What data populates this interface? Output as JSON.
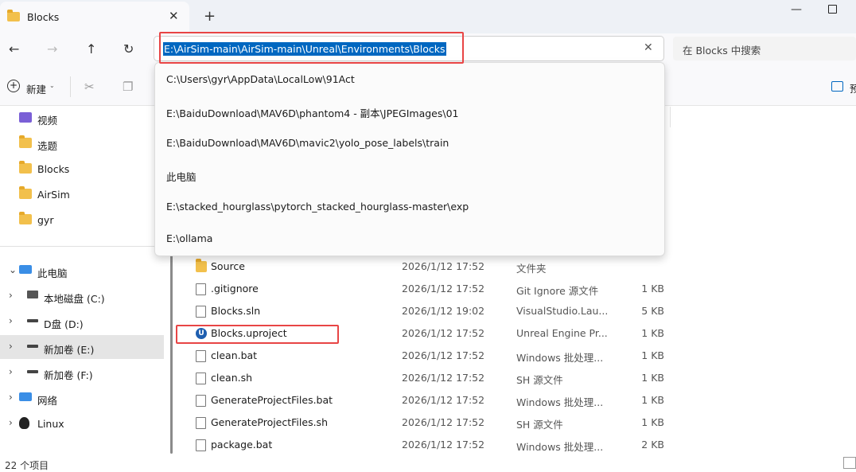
{
  "tab": {
    "title": "Blocks",
    "close": "✕",
    "new": "+"
  },
  "window": {
    "minimize": "—"
  },
  "nav": {
    "back": "←",
    "forward": "→",
    "up": "↑",
    "refresh": "↻"
  },
  "address": {
    "value": "E:\\AirSim-main\\AirSim-main\\Unreal\\Environments\\Blocks",
    "clear": "✕"
  },
  "search": {
    "placeholder": "在 Blocks 中搜索"
  },
  "toolbar": {
    "new_icon": "+",
    "new_label": "新建",
    "new_caret": "⌄",
    "cut": "✂",
    "copy": "❐",
    "preview_label": "预"
  },
  "suggestions": [
    "C:\\Users\\gyr\\AppData\\LocalLow\\91Act",
    "E:\\BaiduDownload\\MAV6D\\phantom4 - 副本\\JPEGImages\\01",
    "E:\\BaiduDownload\\MAV6D\\mavic2\\yolo_pose_labels\\train",
    "此电脑",
    "E:\\stacked_hourglass\\pytorch_stacked_hourglass-master\\exp",
    "E:\\ollama"
  ],
  "sidebar": {
    "quick": [
      {
        "label": "视频",
        "icon": "video-folder-icon",
        "color": "#7a5fd6"
      },
      {
        "label": "选题",
        "icon": "folder-icon"
      },
      {
        "label": "Blocks",
        "icon": "folder-icon"
      },
      {
        "label": "AirSim",
        "icon": "folder-icon"
      },
      {
        "label": "gyr",
        "icon": "folder-icon"
      }
    ],
    "this_pc": "此电脑",
    "drives": [
      {
        "label": "本地磁盘 (C:)",
        "icon": "windows-drive-icon"
      },
      {
        "label": "D盘 (D:)",
        "icon": "drive-icon"
      },
      {
        "label": "新加卷 (E:)",
        "icon": "drive-icon",
        "selected": true
      },
      {
        "label": "新加卷 (F:)",
        "icon": "drive-icon"
      }
    ],
    "network": "网络",
    "linux": "Linux",
    "chevron": "›",
    "chevron_open": "⌄"
  },
  "files": [
    {
      "name": "Source",
      "date": "2026/1/12 17:52",
      "type": "文件夹",
      "size": "",
      "icon": "folder-icon"
    },
    {
      "name": ".gitignore",
      "date": "2026/1/12 17:52",
      "type": "Git Ignore 源文件",
      "size": "1 KB",
      "icon": "gear-file-icon"
    },
    {
      "name": "Blocks.sln",
      "date": "2026/1/12 19:02",
      "type": "VisualStudio.Lau...",
      "size": "5 KB",
      "icon": "file-icon"
    },
    {
      "name": "Blocks.uproject",
      "date": "2026/1/12 17:52",
      "type": "Unreal Engine Pr...",
      "size": "1 KB",
      "icon": "unreal-engine-icon"
    },
    {
      "name": "clean.bat",
      "date": "2026/1/12 17:52",
      "type": "Windows 批处理...",
      "size": "1 KB",
      "icon": "script-file-icon"
    },
    {
      "name": "clean.sh",
      "date": "2026/1/12 17:52",
      "type": "SH 源文件",
      "size": "1 KB",
      "icon": "file-icon"
    },
    {
      "name": "GenerateProjectFiles.bat",
      "date": "2026/1/12 17:52",
      "type": "Windows 批处理...",
      "size": "1 KB",
      "icon": "script-file-icon"
    },
    {
      "name": "GenerateProjectFiles.sh",
      "date": "2026/1/12 17:52",
      "type": "SH 源文件",
      "size": "1 KB",
      "icon": "file-icon"
    },
    {
      "name": "package.bat",
      "date": "2026/1/12 17:52",
      "type": "Windows 批处理...",
      "size": "2 KB",
      "icon": "script-file-icon"
    }
  ],
  "status": {
    "count": "22 个项目"
  },
  "colors": {
    "accent": "#0067c0",
    "highlight": "#e84545",
    "folder": "#f2c04c"
  }
}
